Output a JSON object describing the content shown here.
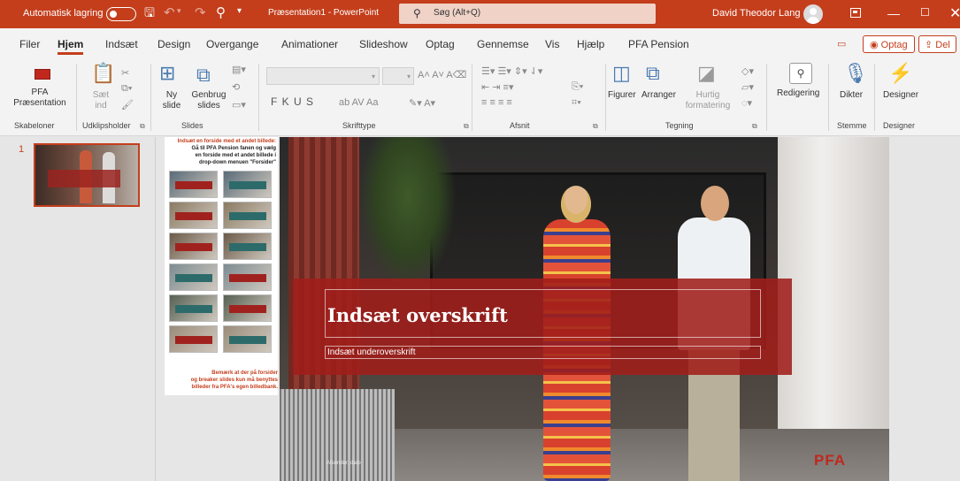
{
  "titlebar": {
    "autosave_label": "Automatisk lagring",
    "document_title": "Præsentation1 - PowerPoint",
    "search_placeholder": "Søg (Alt+Q)",
    "user_name": "David Theodor Lang",
    "icons": [
      "save-icon",
      "undo-icon",
      "redo-icon",
      "presenter-icon",
      "customize-icon",
      "search-icon",
      "avatar",
      "ribbon-display-icon",
      "minimize-icon",
      "maximize-icon",
      "close-icon"
    ]
  },
  "tabs": {
    "items": [
      "Filer",
      "Hjem",
      "Indsæt",
      "Design",
      "Overgange",
      "Animationer",
      "Slideshow",
      "Optag",
      "Gennemse",
      "Vis",
      "Hjælp",
      "PFA Pension"
    ],
    "active": "Hjem",
    "record_label": "Optag",
    "share_label": "Del"
  },
  "ribbon": {
    "templates": {
      "button": [
        "PFA",
        "Præsentation"
      ],
      "group": "Skabeloner"
    },
    "clipboard": {
      "paste": [
        "Sæt",
        "ind"
      ],
      "group": "Udklipsholder"
    },
    "slides": {
      "new_slide": [
        "Ny",
        "slide"
      ],
      "reuse": [
        "Genbrug",
        "slides"
      ],
      "group": "Slides"
    },
    "font": {
      "format_buttons": "F K U S",
      "group": "Skrifttype"
    },
    "paragraph": {
      "group": "Afsnit"
    },
    "drawing": {
      "shapes": "Figurer",
      "arrange": "Arranger",
      "quick_styles": [
        "Hurtig",
        "formatering"
      ],
      "group": "Tegning"
    },
    "editing": {
      "label": "Redigering"
    },
    "voice": {
      "dictate": "Dikter",
      "group": "Stemme"
    },
    "designer": {
      "label": "Designer",
      "group": "Designer"
    }
  },
  "thumbnails": [
    {
      "number": "1",
      "selected": true
    }
  ],
  "instructions": {
    "heading_red": "Indsæt en forside med et andet billede:",
    "heading_lines": [
      "Gå til PFA Pension fanen og vælg",
      "en forside med et andet billede i",
      "drop-down menuen \"Forsider\""
    ],
    "footer_lines": [
      "Bemærk at der på forsider",
      "og breaker slides kun må benyttes",
      "billeder fra PFA's egen billedbank."
    ],
    "thumb_band_colors": [
      "#a0221e",
      "#2d6b6a",
      "#a0221e",
      "#2d6b6a",
      "#a0221e",
      "#2d6b6a",
      "#2d6b6a",
      "#a0221e",
      "#2d6b6a",
      "#a0221e",
      "#a0221e",
      "#2d6b6a"
    ]
  },
  "slide": {
    "title": "Indsæt overskrift",
    "subtitle": "Indsæt underoverskrift",
    "sender": "Afsender, dato",
    "logo": "PFA"
  },
  "colors": {
    "accent": "#c43e1c",
    "band": "#a01e1a",
    "logo": "#c0281e"
  }
}
